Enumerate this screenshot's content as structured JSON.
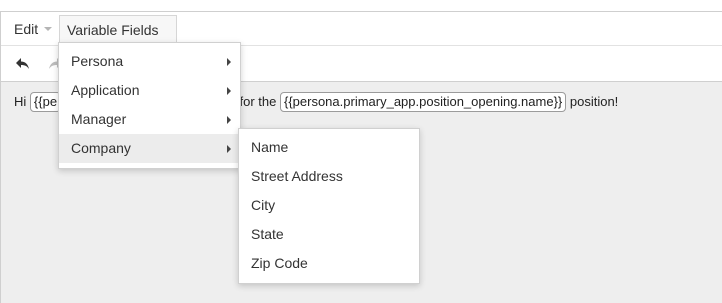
{
  "menubar": {
    "edit_label": "Edit",
    "variable_fields_label": "Variable Fields"
  },
  "toolbar": {
    "undo_icon": "undo-icon",
    "redo_icon": "redo-icon"
  },
  "content": {
    "prefix": "Hi",
    "chip1": "{{pe",
    "middle": "pplying for the",
    "chip2": "{{persona.primary_app.position_opening.name}}",
    "suffix": "position!"
  },
  "variable_menu": {
    "items": [
      {
        "label": "Persona"
      },
      {
        "label": "Application"
      },
      {
        "label": "Manager"
      },
      {
        "label": "Company"
      }
    ]
  },
  "company_submenu": {
    "items": [
      {
        "label": "Name"
      },
      {
        "label": "Street Address"
      },
      {
        "label": "City"
      },
      {
        "label": "State"
      },
      {
        "label": "Zip Code"
      }
    ]
  },
  "colors": {
    "hover_bg": "#ececec",
    "content_bg": "#eeeeee"
  }
}
